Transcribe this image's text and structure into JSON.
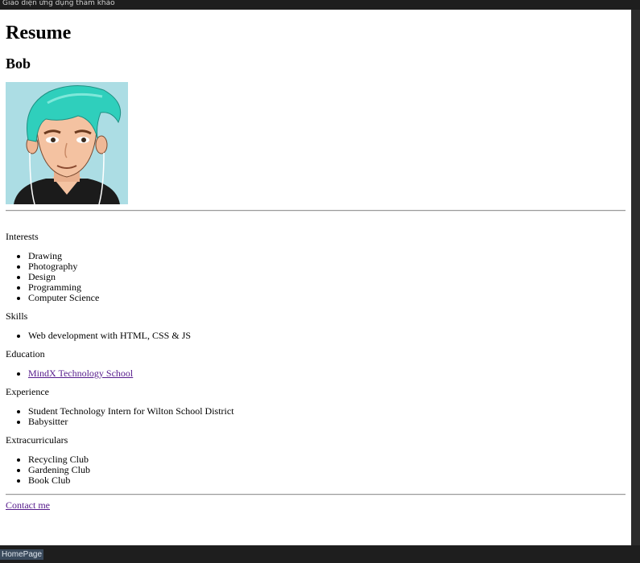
{
  "window": {
    "title": "Giao diện ứng dụng tham khảo",
    "status": "HomePage"
  },
  "resume": {
    "heading": "Resume",
    "name": "Bob",
    "avatar_icon": "cartoon-person-icon",
    "interests": {
      "label": "Interests",
      "items": [
        "Drawing",
        "Photography",
        "Design",
        "Programming",
        "Computer Science"
      ]
    },
    "skills": {
      "label": "Skills",
      "items": [
        "Web development with HTML, CSS & JS"
      ]
    },
    "education": {
      "label": "Education",
      "items": [
        "MindX Technology School"
      ]
    },
    "experience": {
      "label": "Experience",
      "items": [
        "Student Technology Intern for Wilton School District",
        "Babysitter"
      ]
    },
    "extracurriculars": {
      "label": "Extracurriculars",
      "items": [
        "Recycling Club",
        "Gardening Club",
        "Book Club"
      ]
    },
    "contact": "Contact me"
  },
  "colors": {
    "avatar_bg": "#acdde4",
    "hair": "#2fcfbc",
    "skin": "#f4c2a1",
    "visited_link": "#551a8b"
  }
}
